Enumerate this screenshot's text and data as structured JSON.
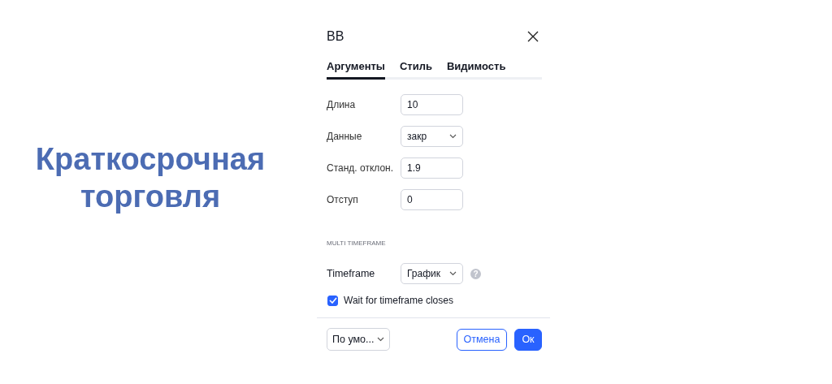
{
  "headline": [
    "Краткосрочная",
    "торговля"
  ],
  "dialog": {
    "title": "BB",
    "tabs": [
      {
        "label": "Аргументы",
        "selected": true
      },
      {
        "label": "Стиль",
        "selected": false
      },
      {
        "label": "Видимость",
        "selected": false
      }
    ],
    "fields": [
      {
        "label": "Длина",
        "kind": "input",
        "value": "10"
      },
      {
        "label": "Данные",
        "kind": "select",
        "value": "закр"
      },
      {
        "label": "Станд. отклон.",
        "kind": "input",
        "value": "1.9"
      },
      {
        "label": "Отступ",
        "kind": "input",
        "value": "0"
      }
    ],
    "section": "MULTI TIMEFRAME",
    "timeframe": {
      "label": "Timeframe",
      "value": "График",
      "help": "?"
    },
    "wait_checkbox": {
      "label": "Wait for timeframe closes",
      "checked": true
    },
    "footer": {
      "preset": "По умо...",
      "cancel": "Отмена",
      "ok": "Ок"
    }
  }
}
